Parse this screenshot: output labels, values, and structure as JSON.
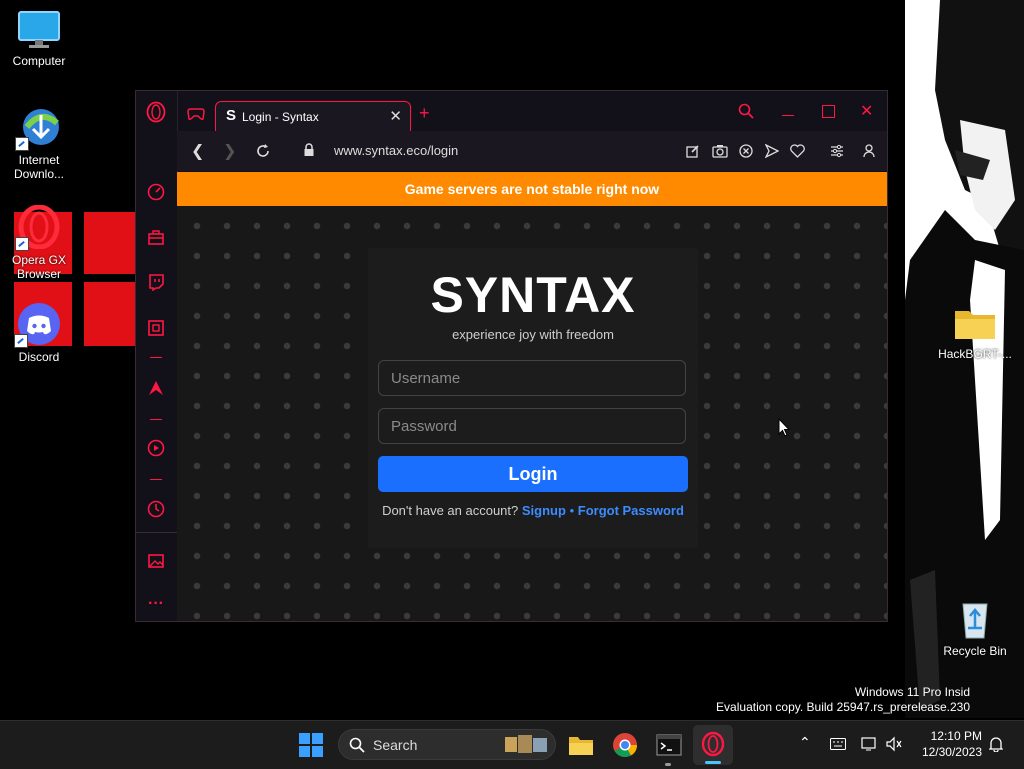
{
  "desktop": {
    "icons": [
      {
        "label": "Computer"
      },
      {
        "label": "Internet Downlo..."
      },
      {
        "label": "Opera GX Browser"
      },
      {
        "label": "Discord"
      },
      {
        "label": "HackBGRT-..."
      },
      {
        "label": "Recycle Bin"
      }
    ],
    "watermark": {
      "line1": "Windows 11 Pro Insid",
      "line2": "Evaluation copy. Build 25947.rs_prerelease.230"
    }
  },
  "browser": {
    "tab": {
      "favicon": "S",
      "title": "Login - Syntax"
    },
    "url": "www.syntax.eco/login",
    "icons": {
      "sidebar": [
        "opera-gx-icon",
        "speed-dial-icon",
        "shopping-bag-icon",
        "twitch-icon",
        "gx-corner-icon",
        "arcade-icon",
        "player-icon",
        "history-icon",
        "gallery-icon",
        "more-icon"
      ],
      "toolbar": [
        "edit-icon",
        "camera-icon",
        "close-circle-icon",
        "send-icon",
        "heart-icon",
        "settings-icon",
        "profile-icon"
      ]
    },
    "accent_color": "#ff1744"
  },
  "page": {
    "banner": "Game servers are not stable right now",
    "banner_color": "#ff8a00",
    "logo": "SYNTAX",
    "tagline": "experience joy with freedom",
    "username_placeholder": "Username",
    "password_placeholder": "Password",
    "login_button": "Login",
    "login_button_color": "#1a6fff",
    "no_account": "Don't have an account?",
    "signup": "Signup",
    "separator": "•",
    "forgot": "Forgot Password"
  },
  "taskbar": {
    "search": "Search",
    "time": "12:10 PM",
    "date": "12/30/2023"
  }
}
